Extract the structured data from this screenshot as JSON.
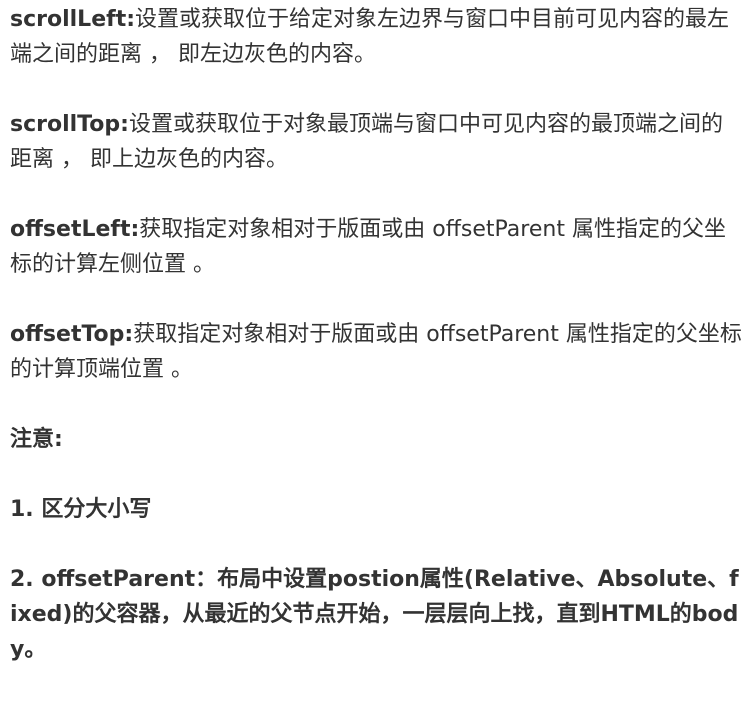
{
  "doc": {
    "items": [
      {
        "term": "scrollLeft:",
        "text": "设置或获取位于给定对象左边界与窗口中目前可见内容的最左端之间的距离 ， 即左边灰色的内容。"
      },
      {
        "term": "scrollTop:",
        "text": "设置或获取位于对象最顶端与窗口中可见内容的最顶端之间的距离 ， 即上边灰色的内容。"
      },
      {
        "term": "offsetLeft:",
        "text": "获取指定对象相对于版面或由 offsetParent 属性指定的父坐标的计算左侧位置 。"
      },
      {
        "term": "offsetTop:",
        "text": "获取指定对象相对于版面或由 offsetParent 属性指定的父坐标的计算顶端位置 。"
      }
    ],
    "note_title": "注意:",
    "notes": [
      "1. 区分大小写",
      "2. offsetParent：布局中设置postion属性(Relative、Absolute、fixed)的父容器，从最近的父节点开始，一层层向上找，直到HTML的body。"
    ]
  }
}
